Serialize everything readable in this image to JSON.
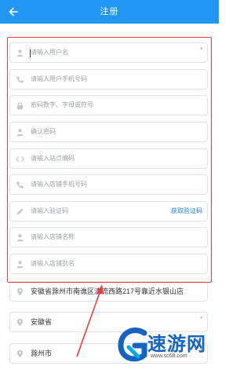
{
  "header": {
    "title": "注册",
    "back_icon": "arrow-left-icon"
  },
  "form": {
    "username": {
      "placeholder": "请输入用户名",
      "required": "*"
    },
    "phone": {
      "placeholder": "请输入用户手机号码"
    },
    "password": {
      "placeholder": "密码数字、字母或符号"
    },
    "confirm_password": {
      "placeholder": "确认密码"
    },
    "site_code": {
      "placeholder": "请输入站点编码"
    },
    "store_phone": {
      "placeholder": "请输入店铺手机号码"
    },
    "verify_code": {
      "placeholder": "请输入验证码",
      "action_label": "获取验证码"
    },
    "store_name": {
      "placeholder": "请输入店铺名称"
    },
    "store_alias": {
      "placeholder": "请输入店铺别名"
    },
    "address": {
      "value": "安徽省滁州市南谯区清流西路217号靠近水银山店"
    },
    "province": {
      "value": "安徽省",
      "required": "*"
    },
    "city": {
      "value": "滁州市",
      "required": "*"
    }
  },
  "watermark": {
    "text": "速游网",
    "url": "www.sc68.com"
  },
  "colors": {
    "header": "#2196f3",
    "highlight_box": "#ef3b3b",
    "link": "#1e88e5"
  }
}
